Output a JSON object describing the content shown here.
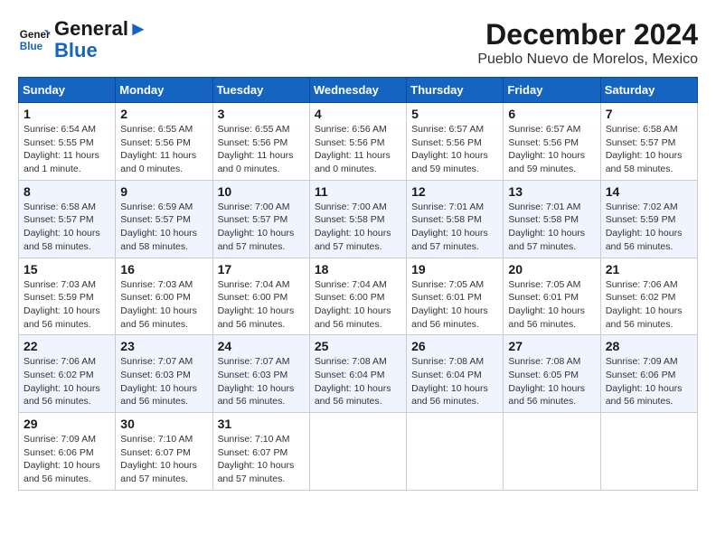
{
  "logo": {
    "line1": "General",
    "line2": "Blue"
  },
  "title": "December 2024",
  "location": "Pueblo Nuevo de Morelos, Mexico",
  "days_of_week": [
    "Sunday",
    "Monday",
    "Tuesday",
    "Wednesday",
    "Thursday",
    "Friday",
    "Saturday"
  ],
  "weeks": [
    [
      {
        "day": "1",
        "info": "Sunrise: 6:54 AM\nSunset: 5:55 PM\nDaylight: 11 hours\nand 1 minute."
      },
      {
        "day": "2",
        "info": "Sunrise: 6:55 AM\nSunset: 5:56 PM\nDaylight: 11 hours\nand 0 minutes."
      },
      {
        "day": "3",
        "info": "Sunrise: 6:55 AM\nSunset: 5:56 PM\nDaylight: 11 hours\nand 0 minutes."
      },
      {
        "day": "4",
        "info": "Sunrise: 6:56 AM\nSunset: 5:56 PM\nDaylight: 11 hours\nand 0 minutes."
      },
      {
        "day": "5",
        "info": "Sunrise: 6:57 AM\nSunset: 5:56 PM\nDaylight: 10 hours\nand 59 minutes."
      },
      {
        "day": "6",
        "info": "Sunrise: 6:57 AM\nSunset: 5:56 PM\nDaylight: 10 hours\nand 59 minutes."
      },
      {
        "day": "7",
        "info": "Sunrise: 6:58 AM\nSunset: 5:57 PM\nDaylight: 10 hours\nand 58 minutes."
      }
    ],
    [
      {
        "day": "8",
        "info": "Sunrise: 6:58 AM\nSunset: 5:57 PM\nDaylight: 10 hours\nand 58 minutes."
      },
      {
        "day": "9",
        "info": "Sunrise: 6:59 AM\nSunset: 5:57 PM\nDaylight: 10 hours\nand 58 minutes."
      },
      {
        "day": "10",
        "info": "Sunrise: 7:00 AM\nSunset: 5:57 PM\nDaylight: 10 hours\nand 57 minutes."
      },
      {
        "day": "11",
        "info": "Sunrise: 7:00 AM\nSunset: 5:58 PM\nDaylight: 10 hours\nand 57 minutes."
      },
      {
        "day": "12",
        "info": "Sunrise: 7:01 AM\nSunset: 5:58 PM\nDaylight: 10 hours\nand 57 minutes."
      },
      {
        "day": "13",
        "info": "Sunrise: 7:01 AM\nSunset: 5:58 PM\nDaylight: 10 hours\nand 57 minutes."
      },
      {
        "day": "14",
        "info": "Sunrise: 7:02 AM\nSunset: 5:59 PM\nDaylight: 10 hours\nand 56 minutes."
      }
    ],
    [
      {
        "day": "15",
        "info": "Sunrise: 7:03 AM\nSunset: 5:59 PM\nDaylight: 10 hours\nand 56 minutes."
      },
      {
        "day": "16",
        "info": "Sunrise: 7:03 AM\nSunset: 6:00 PM\nDaylight: 10 hours\nand 56 minutes."
      },
      {
        "day": "17",
        "info": "Sunrise: 7:04 AM\nSunset: 6:00 PM\nDaylight: 10 hours\nand 56 minutes."
      },
      {
        "day": "18",
        "info": "Sunrise: 7:04 AM\nSunset: 6:00 PM\nDaylight: 10 hours\nand 56 minutes."
      },
      {
        "day": "19",
        "info": "Sunrise: 7:05 AM\nSunset: 6:01 PM\nDaylight: 10 hours\nand 56 minutes."
      },
      {
        "day": "20",
        "info": "Sunrise: 7:05 AM\nSunset: 6:01 PM\nDaylight: 10 hours\nand 56 minutes."
      },
      {
        "day": "21",
        "info": "Sunrise: 7:06 AM\nSunset: 6:02 PM\nDaylight: 10 hours\nand 56 minutes."
      }
    ],
    [
      {
        "day": "22",
        "info": "Sunrise: 7:06 AM\nSunset: 6:02 PM\nDaylight: 10 hours\nand 56 minutes."
      },
      {
        "day": "23",
        "info": "Sunrise: 7:07 AM\nSunset: 6:03 PM\nDaylight: 10 hours\nand 56 minutes."
      },
      {
        "day": "24",
        "info": "Sunrise: 7:07 AM\nSunset: 6:03 PM\nDaylight: 10 hours\nand 56 minutes."
      },
      {
        "day": "25",
        "info": "Sunrise: 7:08 AM\nSunset: 6:04 PM\nDaylight: 10 hours\nand 56 minutes."
      },
      {
        "day": "26",
        "info": "Sunrise: 7:08 AM\nSunset: 6:04 PM\nDaylight: 10 hours\nand 56 minutes."
      },
      {
        "day": "27",
        "info": "Sunrise: 7:08 AM\nSunset: 6:05 PM\nDaylight: 10 hours\nand 56 minutes."
      },
      {
        "day": "28",
        "info": "Sunrise: 7:09 AM\nSunset: 6:06 PM\nDaylight: 10 hours\nand 56 minutes."
      }
    ],
    [
      {
        "day": "29",
        "info": "Sunrise: 7:09 AM\nSunset: 6:06 PM\nDaylight: 10 hours\nand 56 minutes."
      },
      {
        "day": "30",
        "info": "Sunrise: 7:10 AM\nSunset: 6:07 PM\nDaylight: 10 hours\nand 57 minutes."
      },
      {
        "day": "31",
        "info": "Sunrise: 7:10 AM\nSunset: 6:07 PM\nDaylight: 10 hours\nand 57 minutes."
      },
      null,
      null,
      null,
      null
    ]
  ]
}
